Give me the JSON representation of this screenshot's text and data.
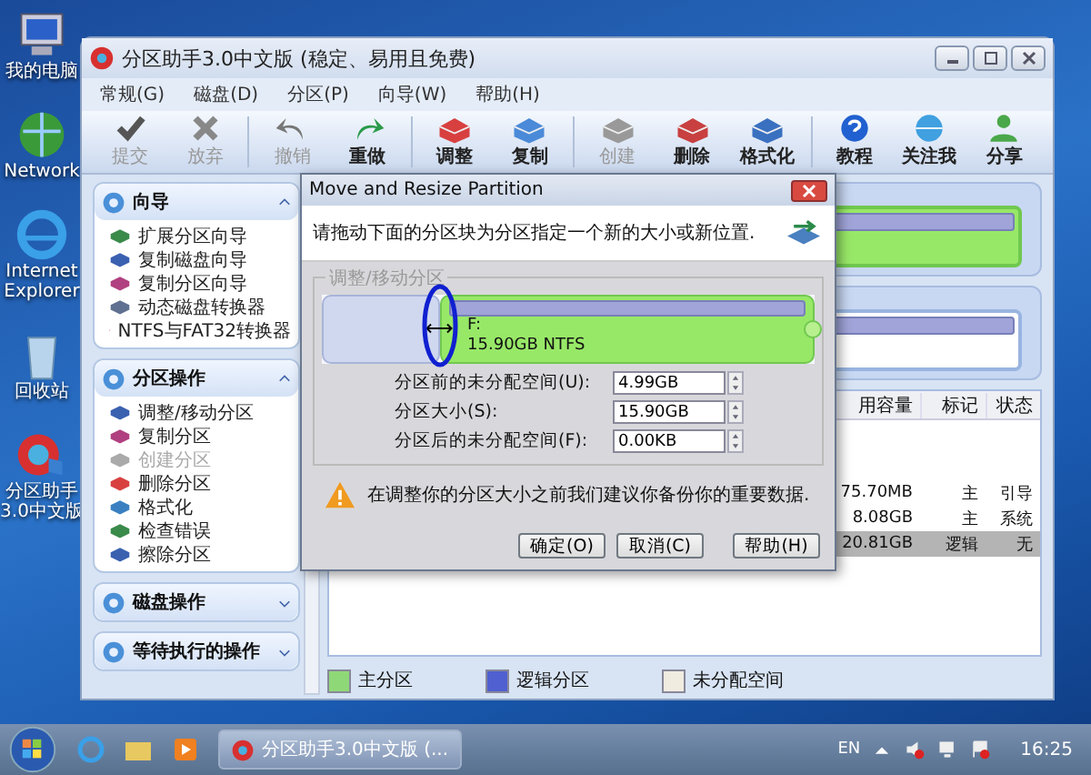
{
  "desktop_icons": [
    {
      "label": "我的电脑"
    },
    {
      "label": "Network"
    },
    {
      "label": "Internet Explorer"
    },
    {
      "label": "回收站"
    },
    {
      "label": "分区助手3.0中文版"
    }
  ],
  "window": {
    "title": "分区助手3.0中文版 (稳定、易用且免费)"
  },
  "menu": [
    "常规(G)",
    "磁盘(D)",
    "分区(P)",
    "向导(W)",
    "帮助(H)"
  ],
  "toolbar": [
    {
      "label": "提交",
      "disabled": true
    },
    {
      "label": "放弃",
      "disabled": true
    },
    {
      "label": "撤销",
      "disabled": true
    },
    {
      "label": "重做",
      "disabled": false
    },
    {
      "label": "调整",
      "disabled": false
    },
    {
      "label": "复制",
      "disabled": false
    },
    {
      "label": "创建",
      "disabled": true
    },
    {
      "label": "删除",
      "disabled": false
    },
    {
      "label": "格式化",
      "disabled": false
    },
    {
      "label": "教程",
      "disabled": false
    },
    {
      "label": "关注我",
      "disabled": false
    },
    {
      "label": "分享",
      "disabled": false
    }
  ],
  "sidebar": {
    "sections": [
      {
        "title": "向导",
        "expanded": true,
        "items": [
          {
            "label": "扩展分区向导",
            "disabled": false
          },
          {
            "label": "复制磁盘向导",
            "disabled": false
          },
          {
            "label": "复制分区向导",
            "disabled": false
          },
          {
            "label": "动态磁盘转换器",
            "disabled": false
          },
          {
            "label": "NTFS与FAT32转换器",
            "disabled": false
          }
        ]
      },
      {
        "title": "分区操作",
        "expanded": true,
        "items": [
          {
            "label": "调整/移动分区",
            "disabled": false
          },
          {
            "label": "复制分区",
            "disabled": false
          },
          {
            "label": "创建分区",
            "disabled": true
          },
          {
            "label": "删除分区",
            "disabled": false
          },
          {
            "label": "格式化",
            "disabled": false
          },
          {
            "label": "检查错误",
            "disabled": false
          },
          {
            "label": "擦除分区",
            "disabled": false
          }
        ]
      },
      {
        "title": "磁盘操作",
        "expanded": false
      },
      {
        "title": "等待执行的操作",
        "expanded": false
      }
    ]
  },
  "table": {
    "columns": [
      "用容量",
      "标记",
      "状态"
    ],
    "rows": [
      {
        "cells": [
          "75.70MB",
          "主",
          "引导"
        ],
        "selected": false
      },
      {
        "cells": [
          "8.08GB",
          "主",
          "系统"
        ],
        "selected": false
      },
      {
        "cells": [
          "20.81GB",
          "逻辑",
          "无"
        ],
        "selected": true
      }
    ]
  },
  "legend": [
    {
      "label": "主分区",
      "color": "#8fd878"
    },
    {
      "label": "逻辑分区",
      "color": "#5060d0"
    },
    {
      "label": "未分配空间",
      "color": "#f0ece0"
    }
  ],
  "dialog": {
    "title": "Move and Resize Partition",
    "instruction": "请拖动下面的分区块为分区指定一个新的大小或新位置.",
    "group_label": "调整/移动分区",
    "partition": {
      "letter": "F:",
      "size": "15.90GB NTFS"
    },
    "unallocated_before": {
      "level": 0.24
    },
    "fields": [
      {
        "label": "分区前的未分配空间(U):",
        "value": "4.99GB"
      },
      {
        "label": "分区大小(S):",
        "value": "15.90GB"
      },
      {
        "label": "分区后的未分配空间(F):",
        "value": "0.00KB"
      }
    ],
    "warning": "在调整你的分区大小之前我们建议你备份你的重要数据.",
    "buttons": [
      "确定(O)",
      "取消(C)",
      "帮助(H)"
    ]
  },
  "taskbar": {
    "task": "分区助手3.0中文版 (...",
    "language": "EN",
    "time": "16:25"
  }
}
